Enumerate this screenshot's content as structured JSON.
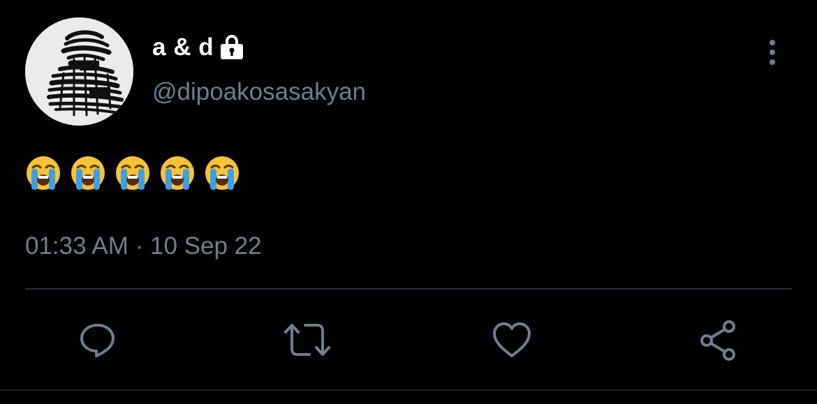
{
  "tweet": {
    "display_name": "a & d",
    "handle": "@dipoakosasakyan",
    "text_emojis": [
      "crying-face",
      "crying-face",
      "crying-face",
      "crying-face",
      "crying-face"
    ],
    "timestamp": "01:33 AM · 10 Sep 22",
    "protected": true
  },
  "icons": {
    "lock": "lock-icon",
    "more": "vertical-ellipsis-icon",
    "reply": "speech-bubble-icon",
    "retweet": "retweet-arrows-icon",
    "like": "heart-icon",
    "share": "share-icon"
  },
  "colors": {
    "background": "#000000",
    "primary_text": "#ffffff",
    "secondary_text": "#6e7d8d",
    "divider": "#2a2f35",
    "icon": "#6e7d8d"
  }
}
